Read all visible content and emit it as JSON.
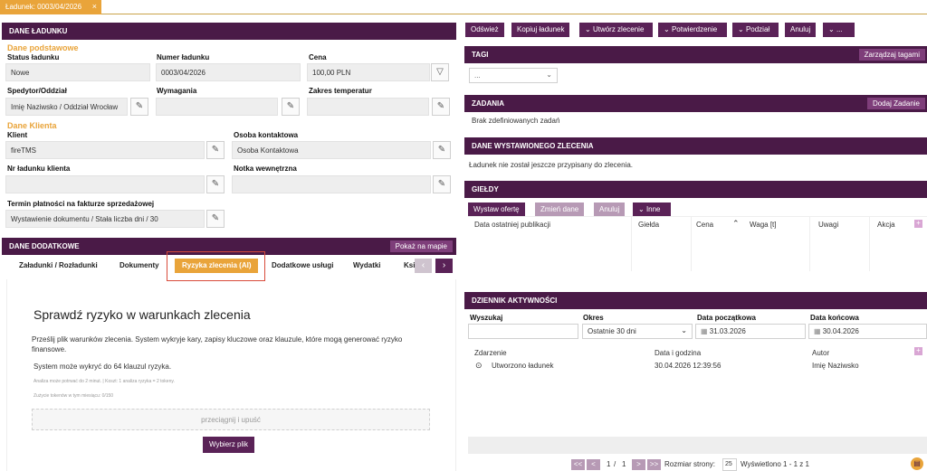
{
  "window_tab": {
    "title": "Ładunek: 0003/04/2026",
    "close": "×"
  },
  "left": {
    "header": "DANE ŁADUNKU",
    "basic_title": "Dane podstawowe",
    "status_label": "Status ładunku",
    "status_value": "Nowe",
    "number_label": "Numer ładunku",
    "number_value": "0003/04/2026",
    "price_label": "Cena",
    "price_value": "100,00 PLN",
    "forwarder_label": "Spedytor/Oddział",
    "forwarder_value": "Imię Naziwsko / Oddział Wrocław",
    "requirements_label": "Wymagania",
    "requirements_value": "",
    "temp_label": "Zakres temperatur",
    "temp_value": "",
    "client_title": "Dane Klienta",
    "client_label": "Klient",
    "client_value": "fireTMS",
    "contact_label": "Osoba kontaktowa",
    "contact_value": "Osoba Kontaktowa",
    "client_no_label": "Nr ładunku klienta",
    "client_no_value": "",
    "note_label": "Notka wewnętrzna",
    "note_value": "",
    "payment_label": "Termin płatności na fakturze sprzedażowej",
    "payment_value": "Wystawienie dokumentu / Stała liczba dni / 30",
    "extra_header": "DANE DODATKOWE",
    "show_map": "Pokaż na mapie",
    "subtabs": [
      "Załadunki / Rozładunki",
      "Dokumenty",
      "Ryzyka zlecenia (AI)",
      "Dodatkowe usługi",
      "Wydatki",
      "Ksi"
    ],
    "risk": {
      "heading": "Sprawdź ryzyko w warunkach zlecenia",
      "desc": "Prześlij plik warunków zlecenia. System wykryje kary, zapisy kluczowe oraz klauzule, które mogą generować ryzyko finansowe.",
      "max": "System może wykryć do 64 klauzul ryzyka.",
      "small1": "Analiza może potrwać do 2 minut. | Koszt: 1 analiza ryzyka = 2 tokeny.",
      "small2": "Zużycie tokenów w tym miesiącu: 0/150",
      "drop": "przeciągnij i upuść",
      "choose": "Wybierz plik"
    }
  },
  "right": {
    "toolbar": [
      "Odśwież",
      "Kopiuj ładunek",
      "Utwórz zlecenie",
      "Potwierdzenie",
      "Podział",
      "Anuluj",
      "..."
    ],
    "tags_header": "TAGI",
    "tags_manage": "Zarządzaj tagami",
    "tags_select": "...",
    "tasks_header": "ZADANIA",
    "tasks_add": "Dodaj Zadanie",
    "tasks_empty": "Brak zdefiniowanych zadań",
    "order_header": "DANE WYSTAWIONEGO ZLECENIA",
    "order_text": "Ładunek nie został jeszcze przypisany do zlecenia.",
    "exchanges_header": "GIEŁDY",
    "exchanges_buttons": [
      "Wystaw ofertę",
      "Zmień dane",
      "Anuluj",
      "Inne"
    ],
    "exchanges_cols": [
      "Data ostatniej publikacji",
      "Giełda",
      "Cena",
      "Waga [t]",
      "Uwagi",
      "Akcja"
    ],
    "log_header": "DZIENNIK AKTYWNOŚCI",
    "log_filters": {
      "search": "Wyszukaj",
      "period": "Okres",
      "period_value": "Ostatnie 30 dni",
      "start": "Data początkowa",
      "start_value": "31.03.2026",
      "end": "Data końcowa",
      "end_value": "30.04.2026"
    },
    "log_cols": [
      "Zdarzenie",
      "Data i godzina",
      "Autor"
    ],
    "log_rows": [
      {
        "event": "Utworzono ładunek",
        "date": "30.04.2026 12:39:56",
        "author": "Imię Naziwsko"
      }
    ],
    "pager": {
      "first": "<<",
      "prev": "<",
      "page": "1",
      "sep": "/",
      "total": "1",
      "next": ">",
      "last": ">>",
      "size_label": "Rozmiar strony:",
      "size": "25",
      "shown": "Wyświetlono 1 - 1 z 1"
    }
  }
}
